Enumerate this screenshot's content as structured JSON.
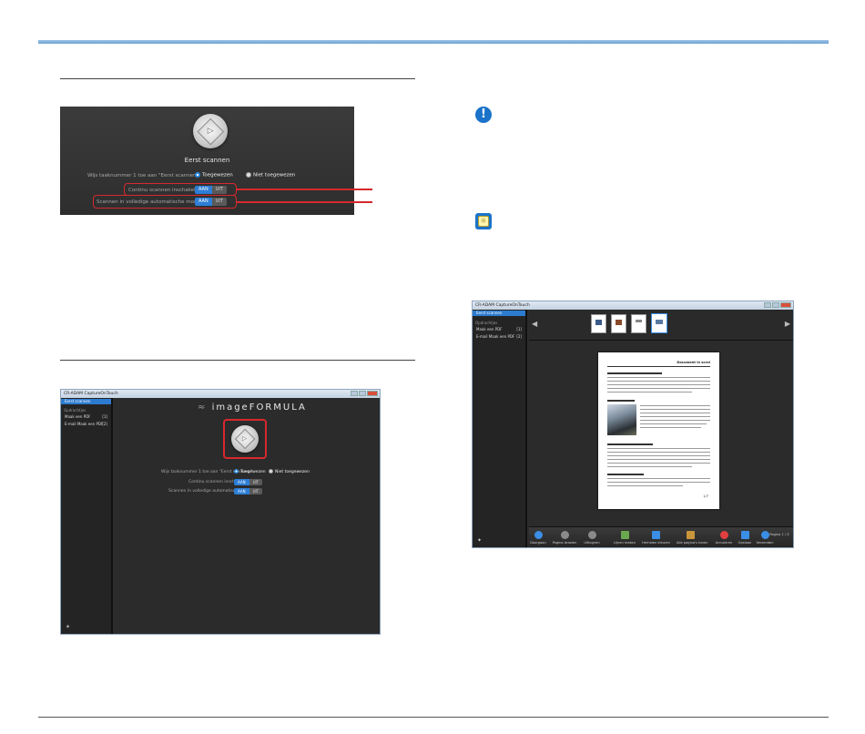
{
  "screenshot1": {
    "title": "Eerst scannen",
    "assign_label": "Wijs taaknummer 1 toe aan \"Eerst scannen\":",
    "radio_assign": "Toegewezen",
    "radio_unassign": "Niet toegewezen",
    "continuous_label": "Continu scannen inschakelen",
    "auto_label": "Scannen in volledige automatische modus",
    "on": "AAN",
    "off": "UIT"
  },
  "screenshot2": {
    "window_title": "CR-ADAM CaptureOnTouch",
    "sidebar_selected": "Eerst scannen",
    "sidebar_group": "Opdrachtjes",
    "items": [
      {
        "label": "Maak een PDF",
        "count": "[1]"
      },
      {
        "label": "E-mail Maak een PDF",
        "count": "[2]"
      }
    ],
    "logo": "imageFORMULA",
    "assign_label": "Wijs taaknummer 1 toe aan \"Eerst scannen\":",
    "radio_assign": "Toegewezen",
    "radio_unassign": "Niet toegewezen",
    "continuous_label": "Continu scannen inschakelen",
    "auto_label": "Scannen in volledige automatische modus",
    "on": "AAN",
    "off": "UIT",
    "pin": "✶"
  },
  "screenshot3": {
    "window_title": "CR-ADAM CaptureOnTouch",
    "sidebar_selected": "Eerst scannen",
    "sidebar_group": "Opdrachtjes",
    "items": [
      {
        "label": "Maak een PDF",
        "count": "[1]"
      },
      {
        "label": "E-mail Maak een PDF",
        "count": "[2]"
      }
    ],
    "page_heading": "Document in scrol",
    "page_number": "1/7",
    "toolbar": [
      {
        "label": "Doorgaan",
        "color": "#3a8ee6"
      },
      {
        "label": "Pagina draaien",
        "color": "#8a8a8a"
      },
      {
        "label": "Uitlognen",
        "color": "#8a8a8a"
      },
      {
        "label": "Lijnen maken",
        "color": "#6aa84f"
      },
      {
        "label": "Herhalen kleuren",
        "color": "#3a8ee6"
      },
      {
        "label": "Alle pagina's tonen",
        "color": "#c8953a"
      },
      {
        "label": "Annuleren",
        "color": "#e04040"
      },
      {
        "label": "Opslaan",
        "color": "#3a8ee6"
      },
      {
        "label": "Verzenden",
        "color": "#3a8ee6"
      }
    ],
    "page_counter": "Pagina 1 / 3"
  }
}
